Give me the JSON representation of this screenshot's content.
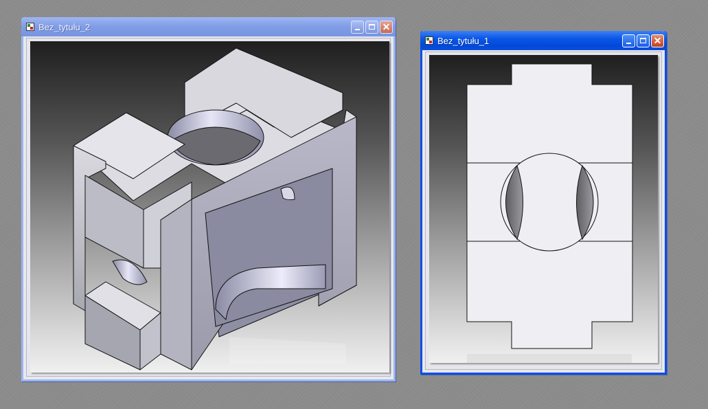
{
  "windows": {
    "left": {
      "title": "Bez_tytułu_2",
      "state": "inactive",
      "view": "isometric"
    },
    "right": {
      "title": "Bez_tytułu_1",
      "state": "active",
      "view": "orthographic-top"
    }
  },
  "controls": {
    "minimize": "minimize",
    "maximize": "maximize",
    "close": "close"
  },
  "icons": [
    "app-icon",
    "minimize-icon",
    "maximize-icon",
    "close-icon"
  ],
  "colors": {
    "active_titlebar": "#0a56e6",
    "inactive_titlebar": "#7f9ce6",
    "desktop": "#8c8c8c",
    "model_face": "#eeeef4"
  }
}
